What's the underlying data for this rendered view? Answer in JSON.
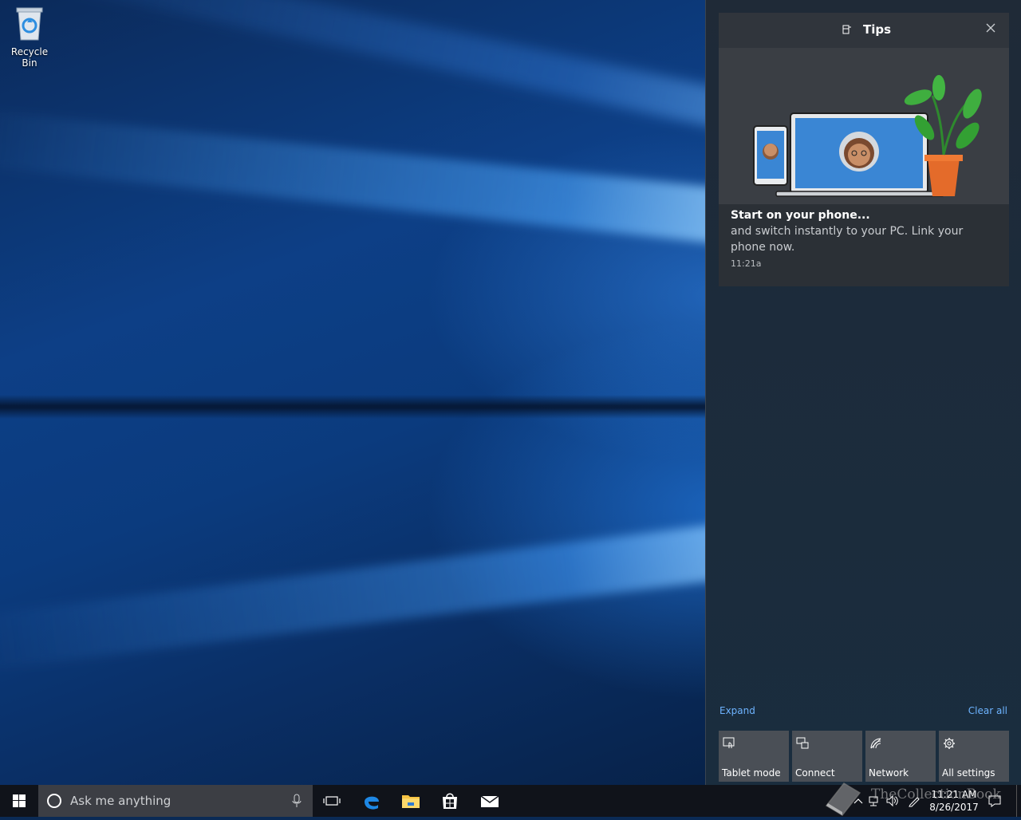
{
  "desktop": {
    "icons": [
      {
        "label": "Recycle Bin",
        "icon": "recycle-bin-icon"
      }
    ]
  },
  "action_center": {
    "notification": {
      "app_name": "Tips",
      "title": "Start on your phone...",
      "body": "and switch instantly to your PC. Link your phone now.",
      "time": "11:21a"
    },
    "expand_label": "Expand",
    "clear_all_label": "Clear all",
    "quick_actions": [
      {
        "label": "Tablet mode",
        "icon": "tablet-mode-icon"
      },
      {
        "label": "Connect",
        "icon": "connect-icon"
      },
      {
        "label": "Network",
        "icon": "network-icon"
      },
      {
        "label": "All settings",
        "icon": "gear-icon"
      }
    ]
  },
  "taskbar": {
    "search_placeholder": "Ask me anything",
    "pinned": [
      "task-view-icon",
      "edge-icon",
      "file-explorer-icon",
      "store-icon",
      "mail-icon"
    ],
    "clock": {
      "time": "11:21 AM",
      "date": "8/26/2017"
    }
  },
  "watermark": {
    "text": "TheCollectionBook"
  },
  "colors": {
    "accent_link": "#6db3ff",
    "taskbar_bg": "#10131a",
    "tile_bg": "#4a4f56",
    "card_bg": "#2b3036"
  }
}
